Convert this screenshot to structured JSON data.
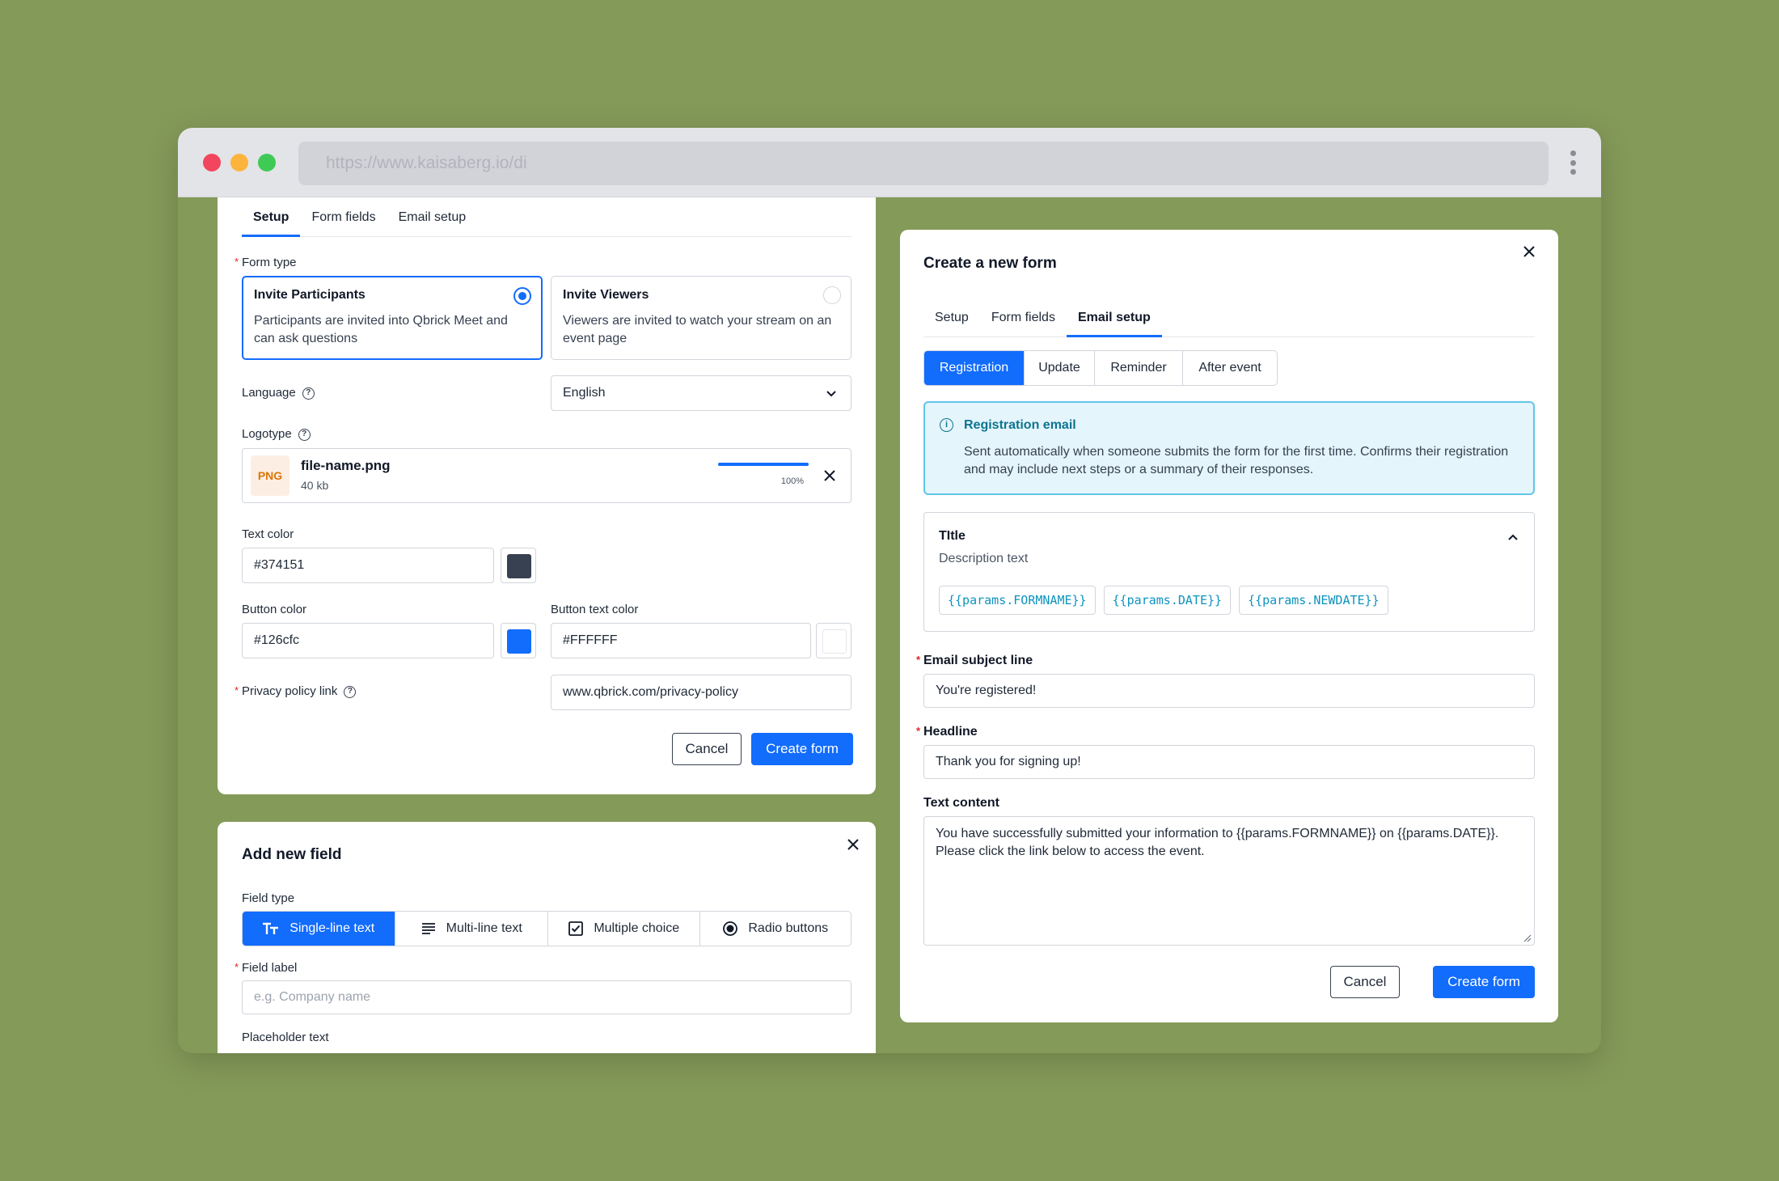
{
  "browser": {
    "url": "https://www.kaisaberg.io/di"
  },
  "setup_card": {
    "tabs": [
      {
        "label": "Setup",
        "active": true
      },
      {
        "label": "Form fields",
        "active": false
      },
      {
        "label": "Email setup",
        "active": false
      }
    ],
    "form_type_label": "Form type",
    "options": [
      {
        "title": "Invite Participants",
        "description": "Participants are invited into Qbrick Meet and can ask questions",
        "selected": true
      },
      {
        "title": "Invite Viewers",
        "description": "Viewers are invited to watch your stream on an event page",
        "selected": false
      }
    ],
    "language_label": "Language",
    "language_value": "English",
    "logotype_label": "Logotype",
    "file": {
      "badge": "PNG",
      "name": "file-name.png",
      "size": "40 kb",
      "progress": 1.0,
      "progress_text": "100%"
    },
    "text_color_label": "Text color",
    "text_color_value": "#374151",
    "button_color_label": "Button color",
    "button_color_value": "#126cfc",
    "button_text_color_label": "Button text color",
    "button_text_color_value": "#FFFFFF",
    "privacy_label": "Privacy policy link",
    "privacy_value": "www.qbrick.com/privacy-policy",
    "cancel_label": "Cancel",
    "create_label": "Create form"
  },
  "add_field_card": {
    "title": "Add new field",
    "field_type_label": "Field type",
    "field_types": [
      {
        "label": "Single-line text",
        "icon": "text-type-icon",
        "active": true
      },
      {
        "label": "Multi-line text",
        "icon": "lines-icon",
        "active": false
      },
      {
        "label": "Multiple choice",
        "icon": "checkbox-icon",
        "active": false
      },
      {
        "label": "Radio buttons",
        "icon": "radio-icon",
        "active": false
      }
    ],
    "field_label_label": "Field label",
    "field_label_placeholder": "e.g. Company name",
    "placeholder_label": "Placeholder text"
  },
  "email_card": {
    "title": "Create a new form",
    "tabs": [
      {
        "label": "Setup",
        "active": false
      },
      {
        "label": "Form fields",
        "active": false
      },
      {
        "label": "Email setup",
        "active": true
      }
    ],
    "segments": [
      {
        "label": "Registration",
        "active": true
      },
      {
        "label": "Update",
        "active": false
      },
      {
        "label": "Reminder",
        "active": false
      },
      {
        "label": "After event",
        "active": false
      }
    ],
    "info": {
      "title": "Registration email",
      "text": "Sent automatically when someone submits the form for the first time. Confirms their registration and may include next steps or a summary of their responses."
    },
    "accordion": {
      "title": "TItle",
      "description": "Description text",
      "chips": [
        "{{params.FORMNAME}}",
        "{{params.DATE}}",
        "{{params.NEWDATE}}"
      ]
    },
    "subject_label": "Email subject line",
    "subject_value": "You're registered!",
    "headline_label": "Headline",
    "headline_value": "Thank you for signing up!",
    "text_content_label": "Text content",
    "text_content_value": "You have successfully submitted your information to {{params.FORMNAME}} on {{params.DATE}}. Please click the link below to access the event.",
    "cancel_label": "Cancel",
    "create_label": "Create form"
  },
  "colors": {
    "page_background": "#849a59",
    "primary": "#126cfc",
    "text_swatch": "#374151",
    "info_border": "#60c6e8",
    "info_background": "#e4f5fb"
  }
}
